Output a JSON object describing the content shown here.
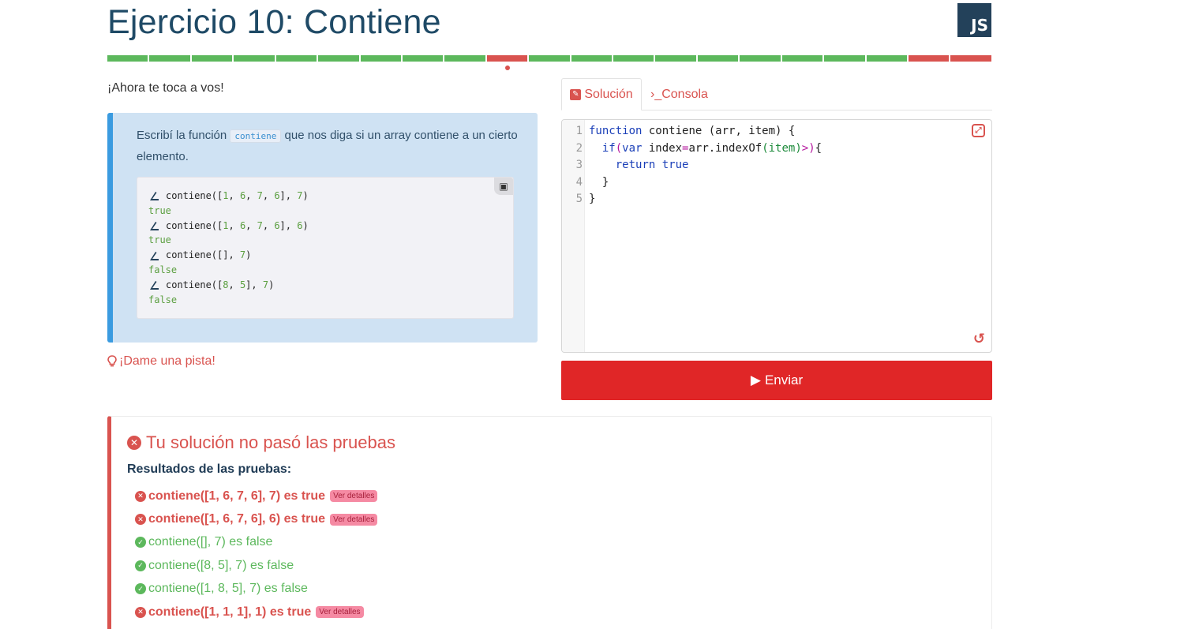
{
  "header": {
    "title": "Ejercicio 10:  Contiene",
    "badge": "JS"
  },
  "progress": {
    "segments": [
      "passed",
      "passed",
      "passed",
      "passed",
      "passed",
      "passed",
      "passed",
      "passed",
      "passed",
      "failed",
      "passed",
      "passed",
      "passed",
      "passed",
      "passed",
      "passed",
      "passed",
      "passed",
      "passed",
      "failed",
      "failed"
    ],
    "current_index": 9
  },
  "intro": "¡Ahora te toca a vos!",
  "description": {
    "text_before": "Escribí la función ",
    "code": "contiene",
    "text_after": " que nos diga si un array contiene a un cierto elemento."
  },
  "examples": [
    {
      "prompt": "contiene([1, 6, 7, 6], 7)",
      "result": "true"
    },
    {
      "prompt": "contiene([1, 6, 7, 6], 6)",
      "result": "true"
    },
    {
      "prompt": "contiene([], 7)",
      "result": "false"
    },
    {
      "prompt": "contiene([8, 5], 7)",
      "result": "false"
    }
  ],
  "hint": "¡Dame una pista!",
  "tabs": {
    "solution": "Solución",
    "console": "›_Consola"
  },
  "editor": {
    "line_numbers": [
      "1",
      "2",
      "3",
      "4",
      "5"
    ]
  },
  "submit_label": "Enviar",
  "results": {
    "title": "Tu solución no pasó las pruebas",
    "subtitle": "Resultados de las pruebas:",
    "details_label": "Ver detalles",
    "tests": [
      {
        "text": "contiene([1, 6, 7, 6], 7) es true",
        "status": "fail"
      },
      {
        "text": "contiene([1, 6, 7, 6], 6) es true",
        "status": "fail"
      },
      {
        "text": "contiene([], 7) es false",
        "status": "pass"
      },
      {
        "text": "contiene([8, 5], 7) es false",
        "status": "pass"
      },
      {
        "text": "contiene([1, 8, 5], 7) es false",
        "status": "pass"
      },
      {
        "text": "contiene([1, 1, 1], 1) es true",
        "status": "fail"
      }
    ]
  },
  "colors": {
    "passed": "#5cb85c",
    "failed": "#d9534f",
    "primary": "#e02627",
    "title": "#1f4a66"
  }
}
